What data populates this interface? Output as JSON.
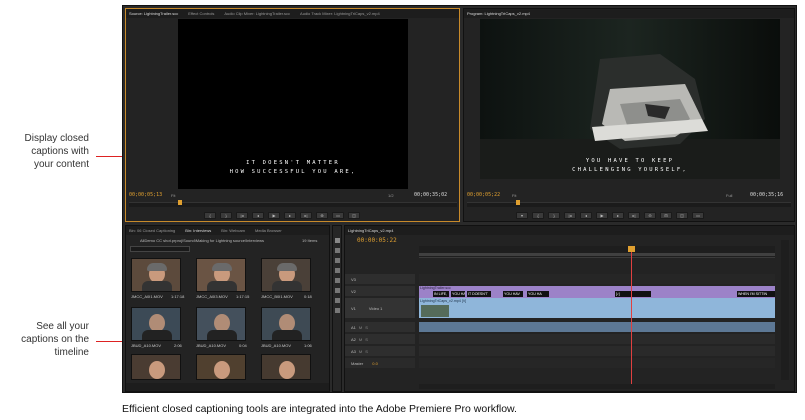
{
  "annotations": {
    "display_callout": "Display closed\ncaptions with\nyour content",
    "timeline_callout": "See all your\ncaptions on the\ntimeline",
    "leader_color": "#d22222"
  },
  "source_monitor": {
    "tabs": [
      "Source: LightningTrailer.scc",
      "Effect Controls",
      "Audio Clip Mixer: LightningTrailer.scc",
      "Audio Track Mixer: LightningTriCaps_v2.mp4"
    ],
    "caption_line1": "IT DOESN'T MATTER",
    "caption_line2": "HOW SUCCESSFUL YOU ARE,",
    "timecode_left": "00;00;05;13",
    "timecode_right": "00;00;35;02",
    "zoom": "Fit",
    "resolution": "1/2"
  },
  "program_monitor": {
    "tab": "Program: LightningTriCaps_v2.mp4",
    "caption_line1": "YOU HAVE TO KEEP",
    "caption_line2": "CHALLENGING YOURSELF,",
    "timecode_left": "00;00;05;22",
    "timecode_right": "00;00;35;16",
    "zoom": "Fit",
    "resolution": "Full"
  },
  "project_panel": {
    "tabs": [
      "Bin: 06 Closed Captioning",
      "Bin: Interviews",
      "Bin: Webcam",
      "Media Browser"
    ],
    "path": "AllDemo CC shot.prproj\\Sound\\Making for Lightning source\\Interviews",
    "items_count": "19 Items",
    "clips": [
      {
        "name": "JMCC_A0I1.MOV",
        "duration": "1:17:18"
      },
      {
        "name": "JMCC_A0I3.MOV",
        "duration": "1:17:15"
      },
      {
        "name": "JMCC_B0I1.MOV",
        "duration": "0:18"
      },
      {
        "name": "JBUD_A10.MOV",
        "duration": "2:06"
      },
      {
        "name": "JBUD_A10.MOV",
        "duration": "0:04"
      },
      {
        "name": "JBUD_A10.MOV",
        "duration": "1:06"
      }
    ]
  },
  "timeline": {
    "tab": "LightningTriCaps_v2.mp4",
    "timecode": "00:00:05:22",
    "tracks": {
      "v3": "V3",
      "v2": "V2",
      "v1": "V1",
      "v1_name": "Video 1",
      "a1": "A1",
      "a2": "A2",
      "a3": "A3",
      "master": "Master",
      "master_level": "0.0"
    },
    "caption_clip_name": "LightningTrailer.scc",
    "video_clip_name": "LightningTriCaps_v2.mp4 [V]",
    "caption_segments": [
      "IN LIFE,",
      "YOU HA",
      "IT DOESN'T",
      "YOU HAV",
      "YOU HA",
      "[♪]",
      "WHEN I'M SITTIN"
    ]
  },
  "footer": "Efficient closed captioning tools are integrated into the Adobe Premiere Pro workflow.",
  "colors": {
    "caption_track": "#9c82c8",
    "video_track": "#8fb6da",
    "playhead": "#e04040",
    "timecode": "#e0a030"
  }
}
